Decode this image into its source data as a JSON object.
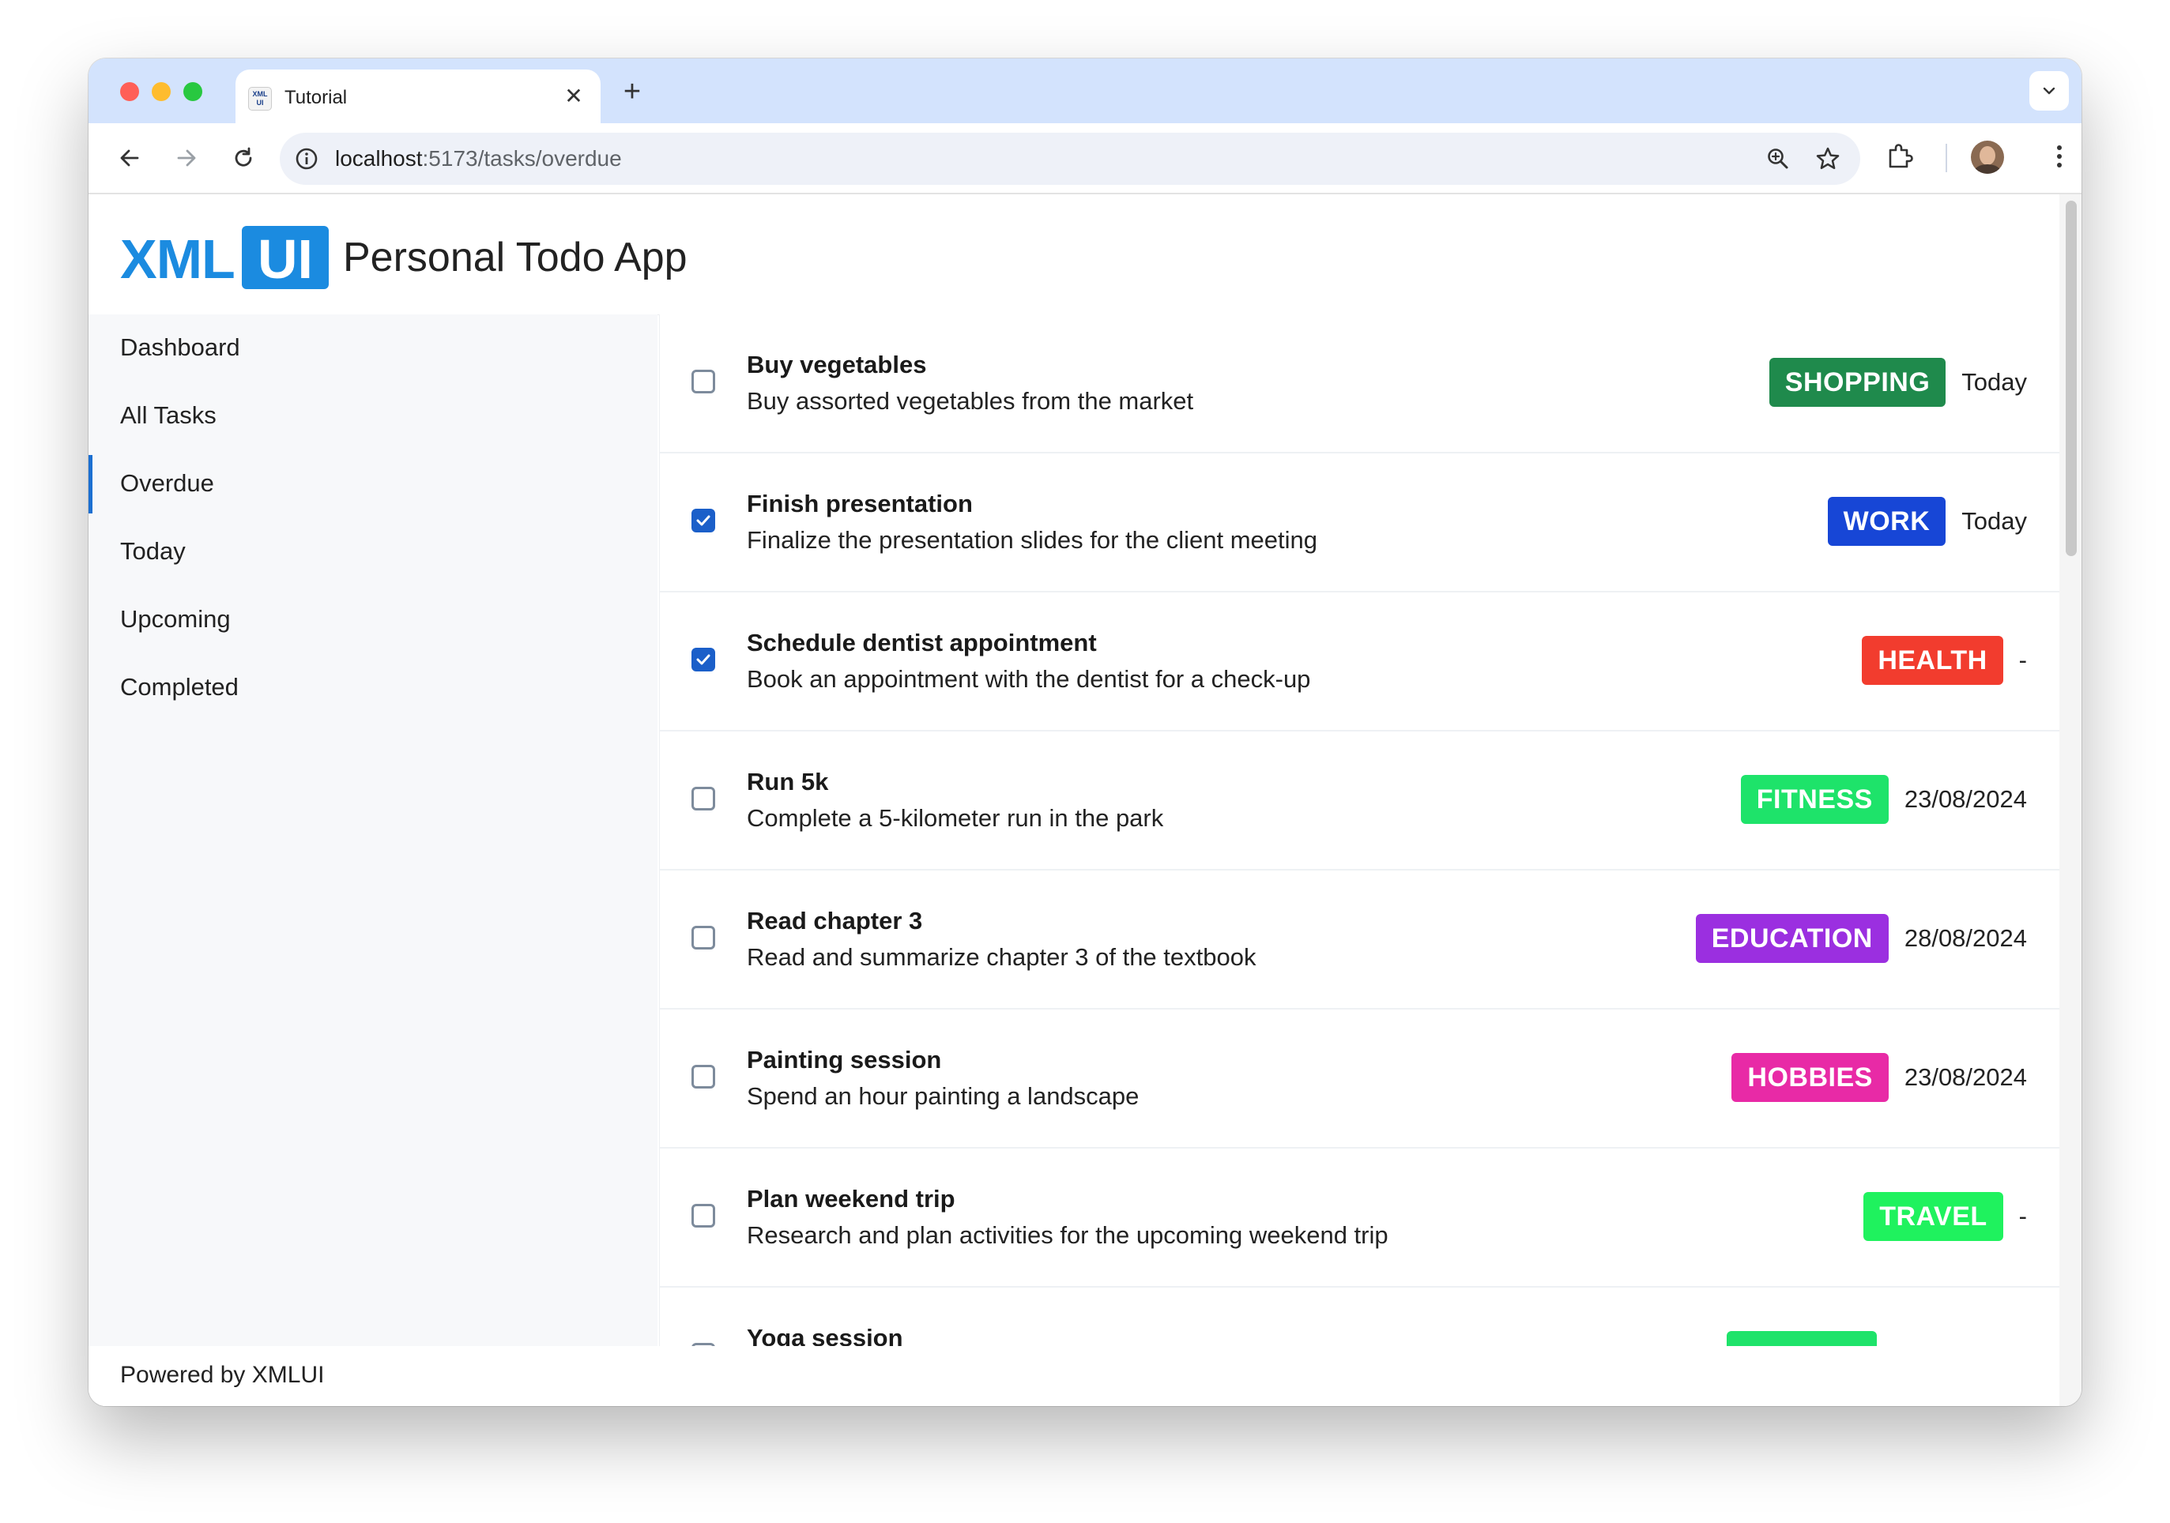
{
  "browser": {
    "tab_title": "Tutorial",
    "favicon_text": "XML UI",
    "url_host": "localhost",
    "url_path": ":5173/tasks/overdue"
  },
  "app": {
    "logo_left": "XML",
    "logo_right": "UI",
    "title": "Personal Todo App",
    "accent_color": "#1b8be0"
  },
  "sidebar": {
    "items": [
      {
        "label": "Dashboard",
        "active": false
      },
      {
        "label": "All Tasks",
        "active": false
      },
      {
        "label": "Overdue",
        "active": true
      },
      {
        "label": "Today",
        "active": false
      },
      {
        "label": "Upcoming",
        "active": false
      },
      {
        "label": "Completed",
        "active": false
      }
    ]
  },
  "tasks": [
    {
      "title": "Buy vegetables",
      "description": "Buy assorted vegetables from the market",
      "category": "SHOPPING",
      "color": "#1f8a4c",
      "date": "Today",
      "done": false
    },
    {
      "title": "Finish presentation",
      "description": "Finalize the presentation slides for the client meeting",
      "category": "WORK",
      "color": "#1746d6",
      "date": "Today",
      "done": true
    },
    {
      "title": "Schedule dentist appointment",
      "description": "Book an appointment with the dentist for a check-up",
      "category": "HEALTH",
      "color": "#f23c2e",
      "date": "-",
      "done": true
    },
    {
      "title": "Run 5k",
      "description": "Complete a 5-kilometer run in the park",
      "category": "FITNESS",
      "color": "#1ee36a",
      "date": "23/08/2024",
      "done": false
    },
    {
      "title": "Read chapter 3",
      "description": "Read and summarize chapter 3 of the textbook",
      "category": "EDUCATION",
      "color": "#9b2fe0",
      "date": "28/08/2024",
      "done": false
    },
    {
      "title": "Painting session",
      "description": "Spend an hour painting a landscape",
      "category": "HOBBIES",
      "color": "#e82aa6",
      "date": "23/08/2024",
      "done": false
    },
    {
      "title": "Plan weekend trip",
      "description": "Research and plan activities for the upcoming weekend trip",
      "category": "TRAVEL",
      "color": "#1ff25e",
      "date": "-",
      "done": false
    },
    {
      "title": "Yoga session",
      "description": "",
      "category": "",
      "color": "#1ee36a",
      "date": "",
      "done": false
    }
  ],
  "footer": {
    "text": "Powered by XMLUI"
  }
}
